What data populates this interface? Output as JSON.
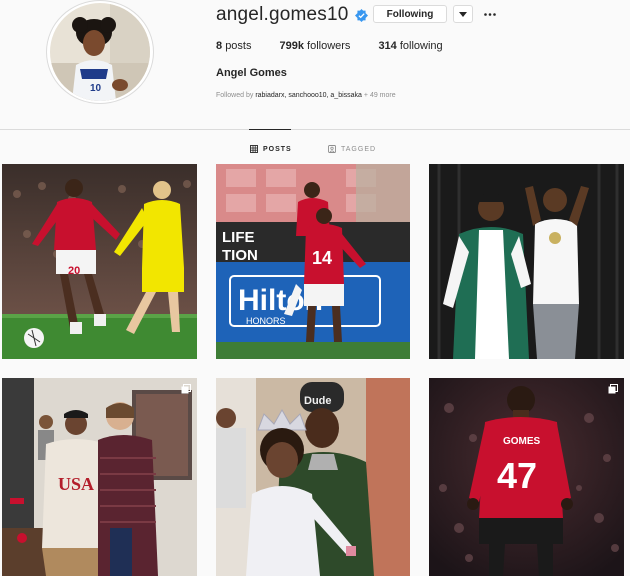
{
  "profile": {
    "username": "angel.gomes10",
    "following_label": "Following",
    "posts_count": "8",
    "posts_label": "posts",
    "followers_count": "799k",
    "followers_label": "followers",
    "following_count": "314",
    "following_text": "following",
    "full_name": "Angel Gomes",
    "followed_by_prefix": "Followed by",
    "followed_by_users": "rabiadarx, sanchooo10, a_bissaka",
    "followed_by_more": "+ 49 more"
  },
  "tabs": [
    {
      "label": "POSTS",
      "active": true
    },
    {
      "label": "TAGGED",
      "active": false
    }
  ],
  "posts": {
    "p1": {
      "shirt_number": "20"
    },
    "p2": {
      "shirt_number": "14",
      "banner_top": "LIFE",
      "banner_sub": "TION",
      "board_text": "Hilton",
      "board_sub": "HONORS"
    },
    "p4": {
      "shirt_text": "USA"
    },
    "p5": {
      "hat_text": "Dude"
    },
    "p6": {
      "shirt_name": "GOMES",
      "shirt_number": "47"
    }
  },
  "colors": {
    "verified_blue": "#3897f0",
    "united_red": "#c8102e",
    "text_primary": "#262626",
    "text_secondary": "#8e8e8e"
  },
  "icons": [
    "verified-icon",
    "chevron-down-icon",
    "more-icon",
    "grid-icon",
    "tag-icon",
    "multiple-posts-icon"
  ]
}
